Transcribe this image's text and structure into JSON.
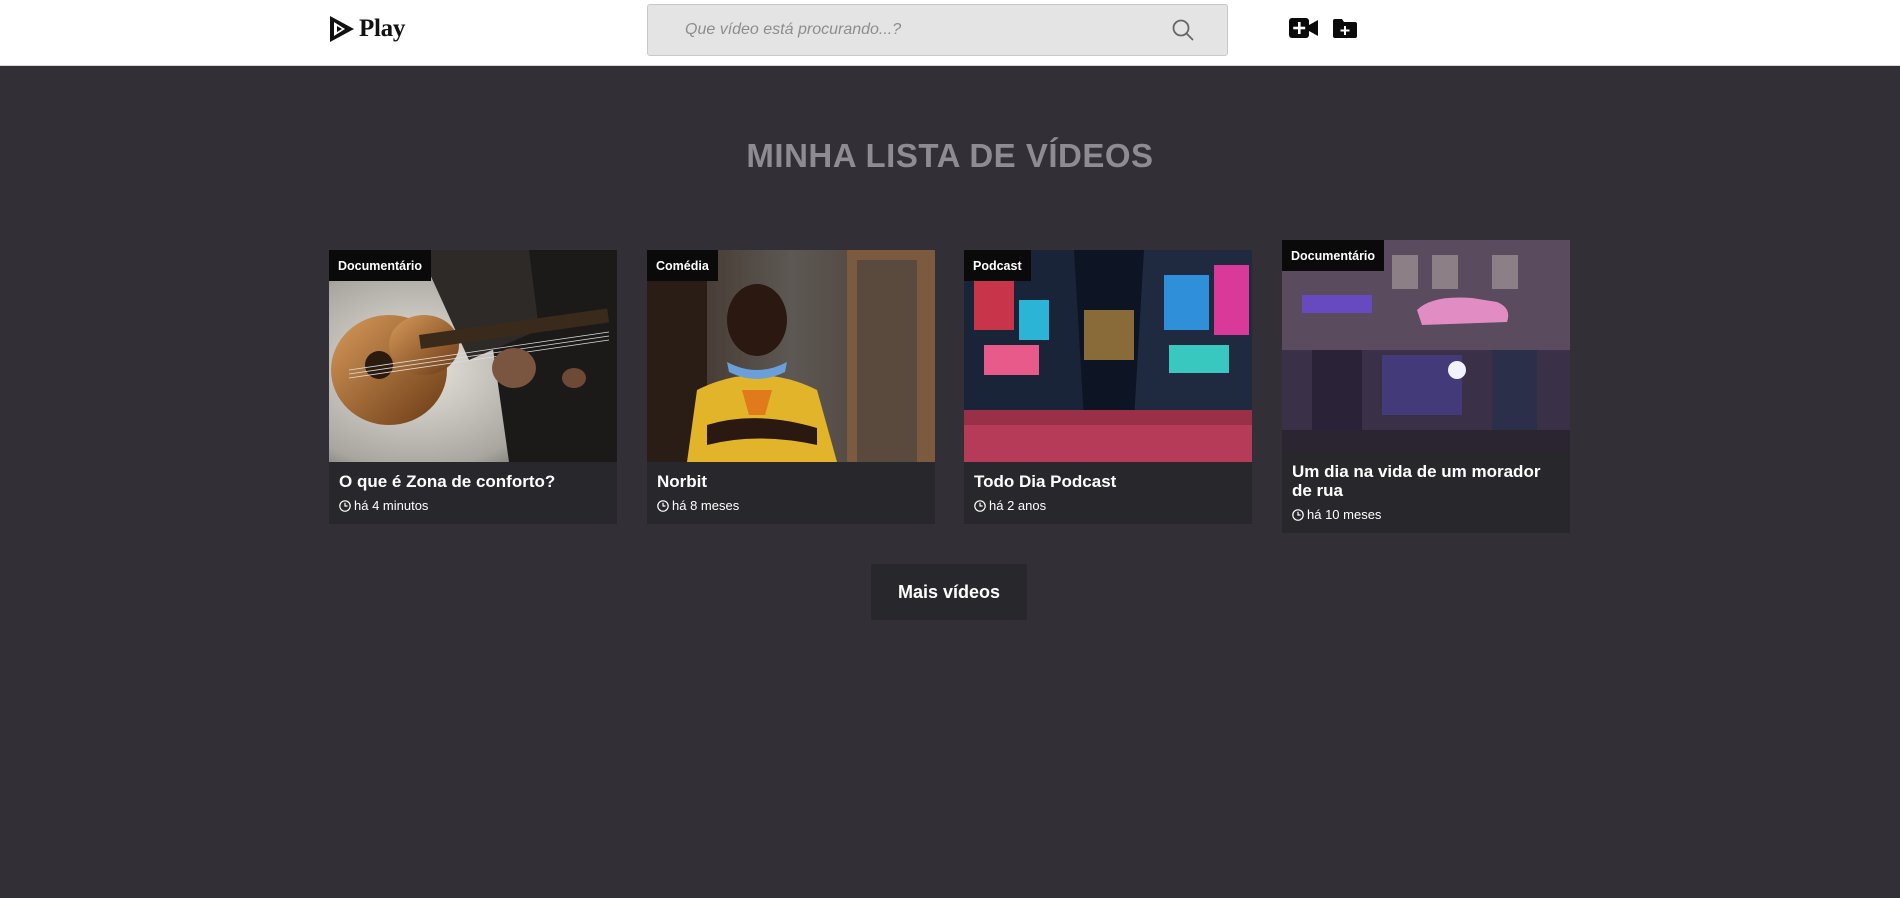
{
  "header": {
    "logo_text": "Play",
    "search": {
      "placeholder": "Que vídeo está procurando...?",
      "value": ""
    },
    "icons": [
      "play-logo-icon",
      "search-icon",
      "add-video-icon",
      "add-folder-icon"
    ]
  },
  "main": {
    "title": "MINHA LISTA DE VÍDEOS",
    "videos": [
      {
        "category": "Documentário",
        "title": "O que é Zona de conforto?",
        "time": "há 4 minutos"
      },
      {
        "category": "Comédia",
        "title": "Norbit",
        "time": "há 8 meses"
      },
      {
        "category": "Podcast",
        "title": "Todo Dia Podcast",
        "time": "há 2 anos"
      },
      {
        "category": "Documentário",
        "title": "Um dia na vida de um morador de rua",
        "time": "há 10 meses"
      }
    ],
    "more_button": "Mais vídeos"
  },
  "colors": {
    "background": "#323036",
    "card": "#28272b",
    "title": "#8f8b92",
    "header": "#ffffff",
    "badge": "#0a0a0a"
  }
}
